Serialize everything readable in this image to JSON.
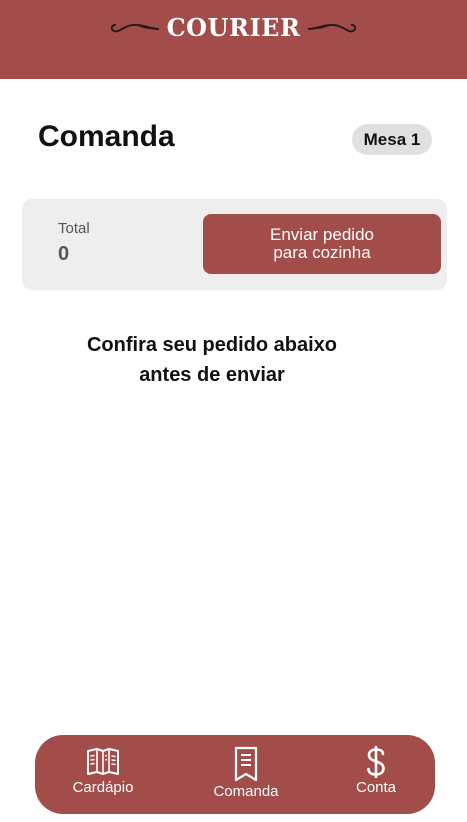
{
  "header": {
    "brand": "COURIER",
    "brand_icon": "flourish-ornament",
    "color": "#a24d4a"
  },
  "main": {
    "title": "Comanda",
    "table_badge": "Mesa 1",
    "summary": {
      "total_label": "Total",
      "total_value": "0",
      "send_button_line1": "Enviar pedido",
      "send_button_line2": "para cozinha"
    },
    "instruction_line1": "Confira seu pedido abaixo",
    "instruction_line2": "antes de enviar"
  },
  "bottom_nav": {
    "items": [
      {
        "label": "Cardápio",
        "icon": "menu-book-icon"
      },
      {
        "label": "Comanda",
        "icon": "receipt-icon"
      },
      {
        "label": "Conta",
        "icon": "dollar-icon"
      }
    ]
  },
  "colors": {
    "accent": "#a24d4a",
    "card_bg": "#eeeeee",
    "badge_bg": "#e0e0e0"
  }
}
